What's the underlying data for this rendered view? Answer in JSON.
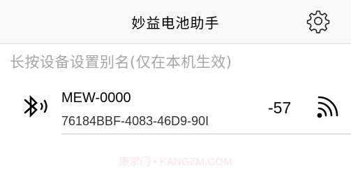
{
  "nav": {
    "title": "妙益电池助手",
    "settings_icon": "gear-icon"
  },
  "section_header": "长按设备设置别名(仅在本机生效)",
  "devices": [
    {
      "name": "MEW-0000",
      "uuid": "76184BBF-4083-46D9-90I",
      "rssi": "-57",
      "icon": "bluetooth-icon",
      "signal_icon": "signal-strength-icon"
    }
  ],
  "watermark": "康掌门 • KANGZM.COM",
  "colors": {
    "nav_background": "#f8f8f8",
    "header_text": "#a6a6a6",
    "divider": "#c8c7cc"
  }
}
